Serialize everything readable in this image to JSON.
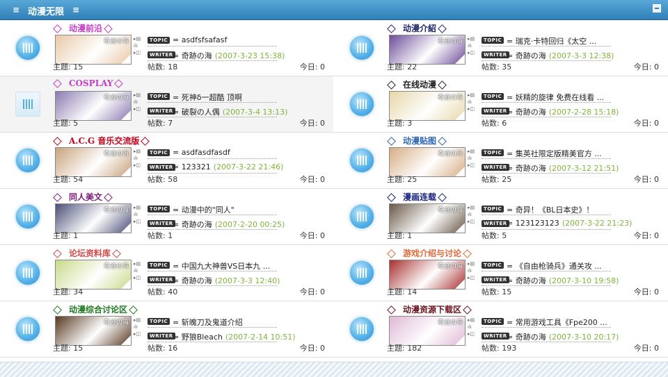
{
  "header": {
    "title": "动漫无限",
    "menu_icon": "menu-icon",
    "collapse_icon": "collapse-icon"
  },
  "labels": {
    "topic_badge": "TOPIC",
    "writer_badge": "WRITER",
    "threads": "主题:",
    "posts": "帖数:",
    "today": "今日:",
    "watermark": "奇迹の海"
  },
  "forums": [
    {
      "name": "动漫前沿",
      "color": "#c63cc6",
      "topic": "= asdfsfsafasf",
      "writer": "= 奇跡の海",
      "date": "(2007-3-23 15:38)",
      "threads": "15",
      "posts": "18",
      "today": "0",
      "thumb": "#e9c9a8"
    },
    {
      "name": "动漫介紹",
      "color": "#1f2a6b",
      "topic": "= 瑞克·卡特回归《太空 ...",
      "writer": "= 奇跡の海",
      "date": "(2007-3-3 12:38)",
      "threads": "22",
      "posts": "35",
      "today": "0",
      "thumb": "#6e4c9a"
    },
    {
      "name": "COSPLAY",
      "color": "#c63cc6",
      "topic": "= 死神δ一超酷 顶啊",
      "writer": "= 破裂の人偶",
      "date": "(2007-3-4 13:13)",
      "threads": "5",
      "posts": "7",
      "today": "0",
      "thumb": "#8b7bb0"
    },
    {
      "name": "在线动漫",
      "color": "#222222",
      "topic": "= 妖精的旋律 免费在线看 ...",
      "writer": "= 奇跡の海",
      "date": "(2007-2-28 15:18)",
      "threads": "3",
      "posts": "6",
      "today": "0",
      "thumb": "#e7d7a8"
    },
    {
      "name": "A.C.G 音乐交流版",
      "color": "#c4001a",
      "topic": "= asdfasdfasdf",
      "writer": "= 123321",
      "date": "(2007-3-22 21:46)",
      "threads": "54",
      "posts": "58",
      "today": "0",
      "thumb": "#c9a27c"
    },
    {
      "name": "动漫贴图",
      "color": "#2e66b5",
      "topic": "= 集英社限定版精美官方 ...",
      "writer": "= 奇跡の海",
      "date": "(2007-3-12 21:51)",
      "threads": "25",
      "posts": "25",
      "today": "0",
      "thumb": "#d7ad84"
    },
    {
      "name": "同人美文",
      "color": "#7a1b7a",
      "topic": "= 动漫中的\"同人\"",
      "writer": "= 奇跡の海",
      "date": "(2007-2-20 00:25)",
      "threads": "1",
      "posts": "1",
      "today": "0",
      "thumb": "#4b4f77"
    },
    {
      "name": "漫画连载",
      "color": "#1a237e",
      "topic": "= 奇异！《BL日本史》！",
      "writer": "= 123123123",
      "date": "(2007-3-22 21:23)",
      "threads": "1",
      "posts": "5",
      "today": "0",
      "thumb": "#6a5848"
    },
    {
      "name": "论坛资料库",
      "color": "#d04a4a",
      "topic": "= 中国九大神兽VS日本九 ...",
      "writer": "= 奇跡の海",
      "date": "(2007-3-3 12:40)",
      "threads": "34",
      "posts": "40",
      "today": "0",
      "thumb": "#c8d98a"
    },
    {
      "name": "游戏介绍与讨论",
      "color": "#e06a3a",
      "topic": "= 《自由枪骑兵》通关攻 ...",
      "writer": "= 奇跡の海",
      "date": "(2007-3-10 19:58)",
      "threads": "14",
      "posts": "15",
      "today": "0",
      "thumb": "#a83030"
    },
    {
      "name": "动漫综合讨论区",
      "color": "#1f7a1f",
      "topic": "= 斩魄刀及鬼道介绍",
      "writer": "= 野狼Bleach",
      "date": "(2007-2-14 10:51)",
      "threads": "15",
      "posts": "16",
      "today": "0",
      "thumb": "#5a3a22"
    },
    {
      "name": "动漫资源下载区",
      "color": "#6a1420",
      "topic": "= 常用游戏工具《Fpe200 ...",
      "writer": "= 奇跡の海",
      "date": "(2007-3-10 20:17)",
      "threads": "182",
      "posts": "193",
      "today": "0",
      "thumb": "#e0b8d6"
    }
  ]
}
